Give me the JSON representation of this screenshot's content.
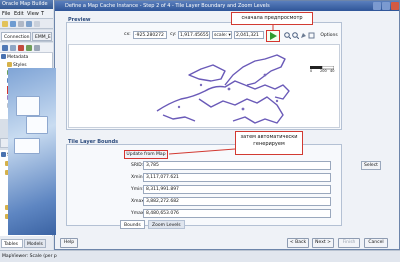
{
  "app": {
    "title": "Oracle Map Builde",
    "menu": [
      "File",
      "Edit",
      "View",
      "T"
    ],
    "connection_tabs": [
      "Connection",
      "EMM_E"
    ],
    "tree": [
      {
        "label": "Metadata",
        "indent": 0
      },
      {
        "label": "Styles",
        "indent": 1
      },
      {
        "label": "Themes",
        "indent": 1
      },
      {
        "label": "Base Maps",
        "indent": 1
      },
      {
        "label": "Tile Layers",
        "indent": 1
      },
      {
        "label": "Truetype Fonts",
        "indent": 1
      },
      {
        "label": "Deleted Items",
        "indent": 1
      }
    ],
    "hide_label": "Hide Data",
    "tree2": [
      {
        "label": "Spatial Tables",
        "indent": 0
      },
      {
        "label": "Annotation Tabl",
        "indent": 1
      },
      {
        "label": "Geometry Tabl",
        "indent": 1
      },
      {
        "label": "OBIEE_MAP",
        "indent": 2
      },
      {
        "label": "STATE",
        "indent": 3
      },
      {
        "label": "STATE",
        "indent": 3
      },
      {
        "label": "GeoRaster Tabl",
        "indent": 1
      },
      {
        "label": "Topology Table",
        "indent": 1
      }
    ],
    "bottom_tabs": [
      "Tables",
      "Models"
    ],
    "status": "MapViewer: Scale (per p"
  },
  "dialog": {
    "title": "Define a Map Cache Instance - Step 2 of 4 - Tile Layer Boundary and Zoom Levels",
    "preview": {
      "label": "Preview",
      "cx_label": "cx:",
      "cx_value": "-925.280272",
      "cy_label": "cy:",
      "cy_value": "1,917.45655",
      "scale_label": "scale:",
      "scale_value": "2,041,321",
      "options_label": "Options",
      "scale_ticks": [
        "0",
        "200",
        "40"
      ]
    },
    "callout_preview": "сначала предпросмотр",
    "bounds": {
      "label": "Tile Layer Bounds",
      "update_label": "Update from Map",
      "select_label": "Select",
      "rows": [
        {
          "label": "SRID:",
          "value": "3,785"
        },
        {
          "label": "Xmin:",
          "value": "3,117,077.621"
        },
        {
          "label": "Ymin:",
          "value": "8,311,991.897"
        },
        {
          "label": "Xmax:",
          "value": "3,882,272.682"
        },
        {
          "label": "Ymax:",
          "value": "8,480,653.076"
        }
      ],
      "tabs": [
        "Bounds",
        "Zoom Levels"
      ]
    },
    "callout_update": "затем автоматически генерируем",
    "buttons": {
      "help": "Help",
      "back": "< Back",
      "next": "Next >",
      "finish": "Finish",
      "cancel": "Cancel"
    }
  },
  "colors": {
    "accent": "#345a94",
    "callout_border": "#d23a32",
    "map_fill": "#7b6cbe"
  }
}
